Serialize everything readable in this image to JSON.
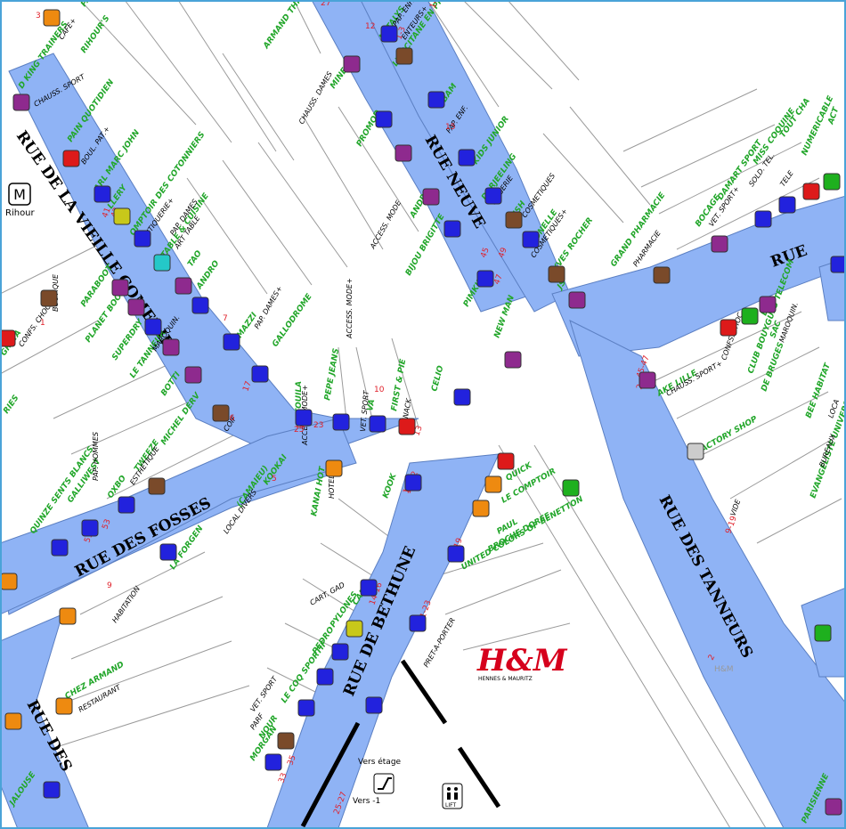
{
  "colors": {
    "street": "#8fb3f5",
    "building_stroke": "#9a9a9a",
    "shop_name": "#22a62a",
    "activity": "#000000",
    "street_number": "#e0202a",
    "street_label": "#000000",
    "hm_logo": "#d6001c",
    "frame": "#4aa3d8"
  },
  "streets": [
    {
      "id": "vieille-comedie",
      "label": "RUE DE LA VIEILLE COMEDIE"
    },
    {
      "id": "neuve",
      "label": "RUE NEUVE"
    },
    {
      "id": "fosses",
      "label": "RUE DES FOSSES"
    },
    {
      "id": "bethune",
      "label": "RUE DE BETHUNE"
    },
    {
      "id": "tanneurs",
      "label": "RUE DES TANNEURS"
    },
    {
      "id": "rue-des",
      "label": "RUE DES"
    },
    {
      "id": "rue-right",
      "label": "RUE"
    }
  ],
  "metro": {
    "icon": "metro-icon",
    "letter": "M",
    "name": "Rihour"
  },
  "hm_logo": {
    "text": "H&M",
    "subtitle": "HENNES & MAURITZ"
  },
  "hm_faint": "H&M",
  "facilities": [
    {
      "id": "stairs",
      "icon": "escalator-icon",
      "line1": "Vers  étage",
      "line2": "Vers  -1"
    },
    {
      "id": "lift",
      "icon": "lift-icon",
      "label": "LIFT"
    }
  ],
  "shop_names": [
    "PAUX",
    "RIHOUR'S",
    "D KING TRAINERS",
    "PAIN QUOTIDIEN",
    "ARL MARC JOHN",
    "LLERY",
    "OMPTOIR DES COTONNIERS",
    "TABLE & CUISINE",
    "TAO",
    "ANDRO",
    "PARABOOT",
    "TOUT",
    "PLANET BOOTS",
    "SUPERDRY",
    "LE TANNEUR",
    "BOTTI",
    "MICHEL DERV",
    "GRATA",
    "RIES",
    "MAZZI",
    "GALLODROME",
    "TWEEZE",
    "OXBO",
    "GALLIWEST",
    "QUINZE SENTS BLANCS",
    "KOOKAI",
    "(CAMAIEU)",
    "TOUILA",
    "PEPE JEANS",
    "VA",
    "FIRST & PIE",
    "CELIO",
    "KANAI HOT",
    "KOOK",
    "LA FORGEN",
    "ARMAND THIERY",
    "MINE",
    "PROMOD",
    "ANDRE",
    "BIJOU BRIGITTE",
    "PIMKIE",
    "NEW MAN",
    "NATALYS",
    "L'OCCITANE EN PROVENCE",
    "BAM",
    "KIDS JUNIOR",
    "DARJEELING",
    "LUSH",
    "YONELLE",
    "YVES ROCHER",
    "JS",
    "GRAND PHARMACIE",
    "BOCAGE",
    "DAMART SPORT",
    "MISS COQUINE",
    "TOUT CHA",
    "NUMERICABLE",
    "ACT",
    "SAC",
    "CLUB BOUYGUES TELECOM",
    "DE BRUGES",
    "FACTORY SHOP",
    "AKE LILLE",
    "BEE HABITAT",
    "EVANGELISTE UNIVERSITAIRE",
    "QUICK",
    "LE COMPTOIR",
    "PAUL",
    "BROCHE DOREE",
    "UNITED COLORS OF BENETTON",
    "CAMA",
    "PYLONES",
    "PEDRO",
    "LE COQ SPORTIF",
    "NOUR",
    "MORGAN",
    "SCOTT",
    "ALAIN",
    "CHEZ ARMAND",
    "JALOUSE",
    "PARISIENNE",
    "LAC"
  ],
  "activities": [
    "CAFE+",
    "CHAUSS. SPORT",
    "BOUL. PAT.+",
    "BOUTIQUE",
    "BOUTIQUERIE+",
    "PAP. DAMES",
    "ART TABLE",
    "CHAUSS. DAMES",
    "PAP. DAMES+",
    "CONFS. CHOC.",
    "ESTHETIQUE",
    "PAP. HOMMES",
    "COIF",
    "MAROQUIN.",
    "ACCESS. MODE+",
    "VET. SPORT",
    "SNACK",
    "HOTEL",
    "LOCAL DIVERS",
    "HABITATION",
    "ACCESS. MODE",
    "PAP. ENF.+",
    "ACCESS. MODE+",
    "ENTEURS+",
    "PAP. ENF.",
    "LINGERIE",
    "COSMETIQUES",
    "COSMETIQUES+",
    "PHARMACIE",
    "VET. SPORT+",
    "SOLD. TEL.",
    "TELE",
    "CHAUSS. SPORT+",
    "CONFS. CHOC.",
    "VIDE",
    "BUREAUX",
    "LOCA",
    "RESTAURANT",
    "PRET-A-PORTER",
    "CART. GAD",
    "PARF",
    "VET. SPORT",
    "MAROQUIN."
  ],
  "street_numbers": [
    "1",
    "2",
    "3",
    "5",
    "7",
    "9",
    "10",
    "11",
    "12",
    "13",
    "14",
    "15",
    "16",
    "17",
    "19",
    "21",
    "23",
    "25",
    "27",
    "33",
    "35",
    "41",
    "43",
    "45",
    "47",
    "49",
    "51",
    "53",
    "9-19",
    "25-27",
    "1-3",
    "10-12",
    "17-19",
    "21-23",
    "14-16",
    "5-7",
    "2-4",
    "45-47"
  ]
}
